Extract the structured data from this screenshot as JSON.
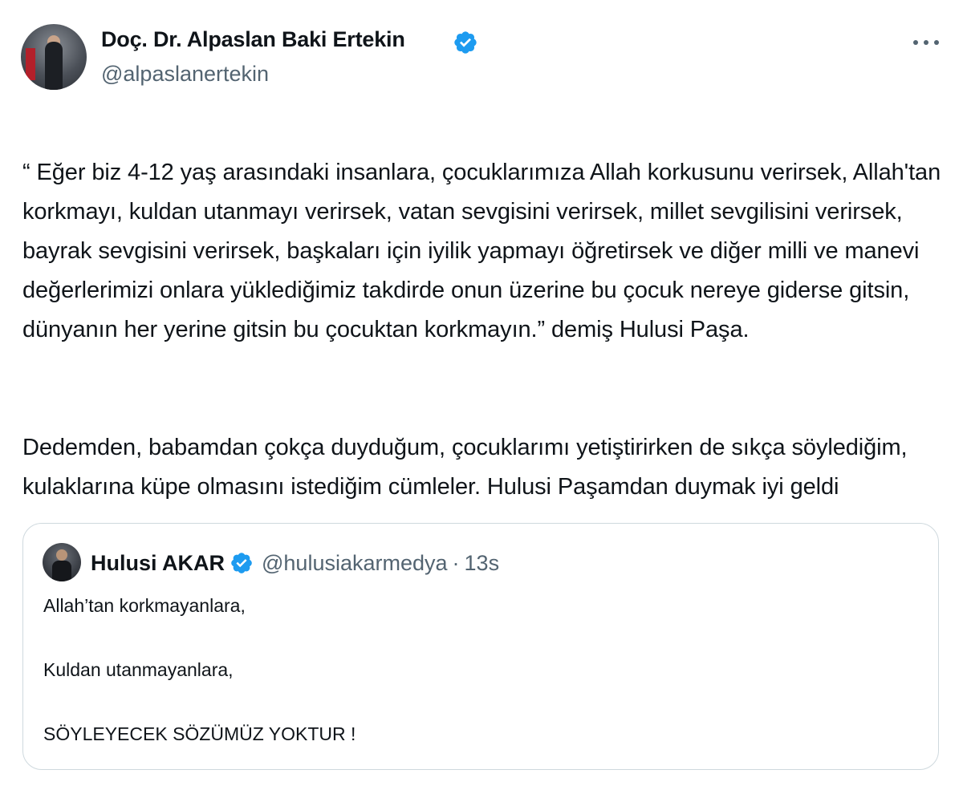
{
  "tweet": {
    "author": {
      "name": "Doç. Dr. Alpaslan Baki Ertekin",
      "handle": "@alpaslanertekin",
      "avatar_icon": "profile-photo-icon",
      "verified_icon": "verified-badge-icon"
    },
    "more_icon": "more-options-icon",
    "paragraphs": [
      "“ Eğer biz 4-12 yaş arasındaki insanlara, çocuklarımıza Allah korkusunu verirsek, Allah'tan korkmayı, kuldan utanmayı verirsek, vatan sevgisini verirsek, millet sevgilisini verirsek, bayrak sevgisini verirsek,  başkaları için iyilik yapmayı öğretirsek ve diğer milli ve manevi değerlerimizi onlara yüklediğimiz takdirde onun üzerine bu çocuk nereye giderse gitsin, dünyanın her yerine gitsin bu çocuktan korkmayın.” demiş Hulusi Paşa.",
      "Dedemden, babamdan çokça duyduğum, çocuklarımı yetiştirirken de sıkça söylediğim, kulaklarına küpe olmasını istediğim cümleler. Hulusi Paşamdan duymak iyi geldi"
    ]
  },
  "quote": {
    "author": {
      "name": "Hulusi AKAR",
      "handle": "@hulusiakarmedya",
      "separator": "·",
      "time": "13s",
      "verified_icon": "verified-badge-icon"
    },
    "paragraphs": [
      "Allah’tan korkmayanlara,",
      "Kuldan utanmayanlara,",
      "SÖYLEYECEK SÖZÜMÜZ YOKTUR !"
    ]
  },
  "colors": {
    "verified_blue": "#1d9bf0",
    "text_primary": "#0f1419",
    "text_secondary": "#536471",
    "border": "#cfd9de"
  }
}
